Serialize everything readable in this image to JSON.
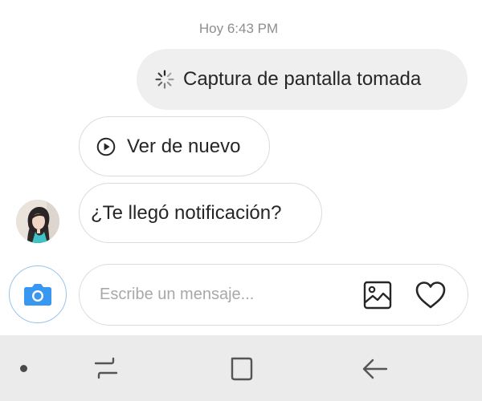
{
  "conversation": {
    "timestamp": "Hoy 6:43 PM",
    "messages": [
      {
        "type": "sent",
        "icon": "screenshot-spinner-icon",
        "text": "Captura de pantalla tomada"
      },
      {
        "type": "received",
        "icon": "play-circle-icon",
        "text": "Ver de nuevo"
      },
      {
        "type": "received",
        "text": "¿Te llegó notificación?"
      }
    ]
  },
  "composer": {
    "placeholder": "Escribe un mensaje...",
    "camera_icon": "camera-icon",
    "gallery_icon": "gallery-icon",
    "like_icon": "heart-icon",
    "camera_color": "#3897f0"
  },
  "navigation_bar": {
    "buttons": [
      "recent-apps-icon",
      "home-icon",
      "back-icon"
    ]
  }
}
